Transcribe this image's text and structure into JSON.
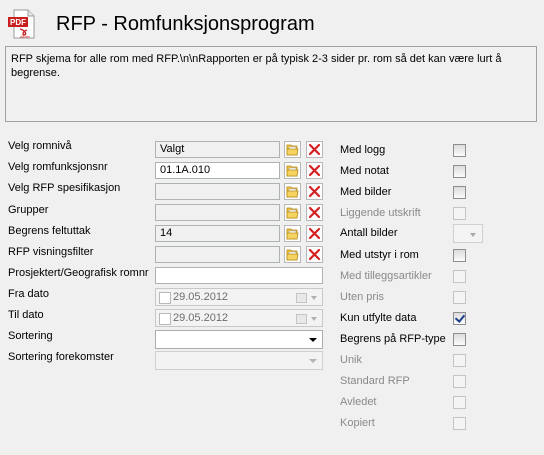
{
  "header": {
    "title": "RFP - Romfunksjonsprogram",
    "icon": "pdf-document-icon",
    "icon_text": "PDF",
    "icon_subtext": "Adobe"
  },
  "description": "RFP skjema for alle rom med RFP.\\n\\nRapporten er på typisk 2-3 sider pr. rom så det kan være lurt å begrense.",
  "form": {
    "romniva_label": "Velg romnivå",
    "romniva_value": "Valgt",
    "romfunksjonsnr_label": "Velg romfunksjonsnr",
    "romfunksjonsnr_value": "01.1A.010",
    "rfp_spes_label": "Velg RFP spesifikasjon",
    "rfp_spes_value": "",
    "grupper_label": "Grupper",
    "grupper_value": "",
    "feltuttak_label": "Begrens feltuttak",
    "feltuttak_value": "14",
    "visningsfilter_label": "RFP visningsfilter",
    "visningsfilter_value": "",
    "prosjektert_label": "Prosjektert/Geografisk romnr",
    "prosjektert_value": "",
    "fra_dato_label": "Fra dato",
    "fra_dato_value": "29.05.2012",
    "til_dato_label": "Til dato",
    "til_dato_value": "29.05.2012",
    "sortering_label": "Sortering",
    "sortering_value": "",
    "sortering_forekomster_label": "Sortering forekomster",
    "sortering_forekomster_value": ""
  },
  "options": {
    "med_logg": {
      "label": "Med logg",
      "checked": false,
      "enabled": true
    },
    "med_notat": {
      "label": "Med notat",
      "checked": false,
      "enabled": true
    },
    "med_bilder": {
      "label": "Med bilder",
      "checked": false,
      "enabled": true
    },
    "liggende_utskrift": {
      "label": "Liggende utskrift",
      "checked": false,
      "enabled": false
    },
    "antall_bilder": {
      "label": "Antall bilder",
      "value": ""
    },
    "med_utstyr": {
      "label": "Med utstyr i rom",
      "checked": false,
      "enabled": true
    },
    "med_tilleggsartikler": {
      "label": "Med tilleggsartikler",
      "checked": false,
      "enabled": false
    },
    "uten_pris": {
      "label": "Uten pris",
      "checked": false,
      "enabled": false
    },
    "kun_utfylte": {
      "label": "Kun utfylte data",
      "checked": true,
      "enabled": true
    },
    "begrens_rfp_type": {
      "label": "Begrens på RFP-type",
      "checked": false,
      "enabled": true
    },
    "unik": {
      "label": "Unik",
      "checked": false,
      "enabled": false
    },
    "standard_rfp": {
      "label": "Standard RFP",
      "checked": false,
      "enabled": false
    },
    "avledet": {
      "label": "Avledet",
      "checked": false,
      "enabled": false
    },
    "kopiert": {
      "label": "Kopiert",
      "checked": false,
      "enabled": false
    }
  },
  "colors": {
    "pdf_red": "#c8201f",
    "delete_red": "#d42020",
    "folder_yellow": "#f2c23c",
    "check_blue": "#1c3e87"
  }
}
